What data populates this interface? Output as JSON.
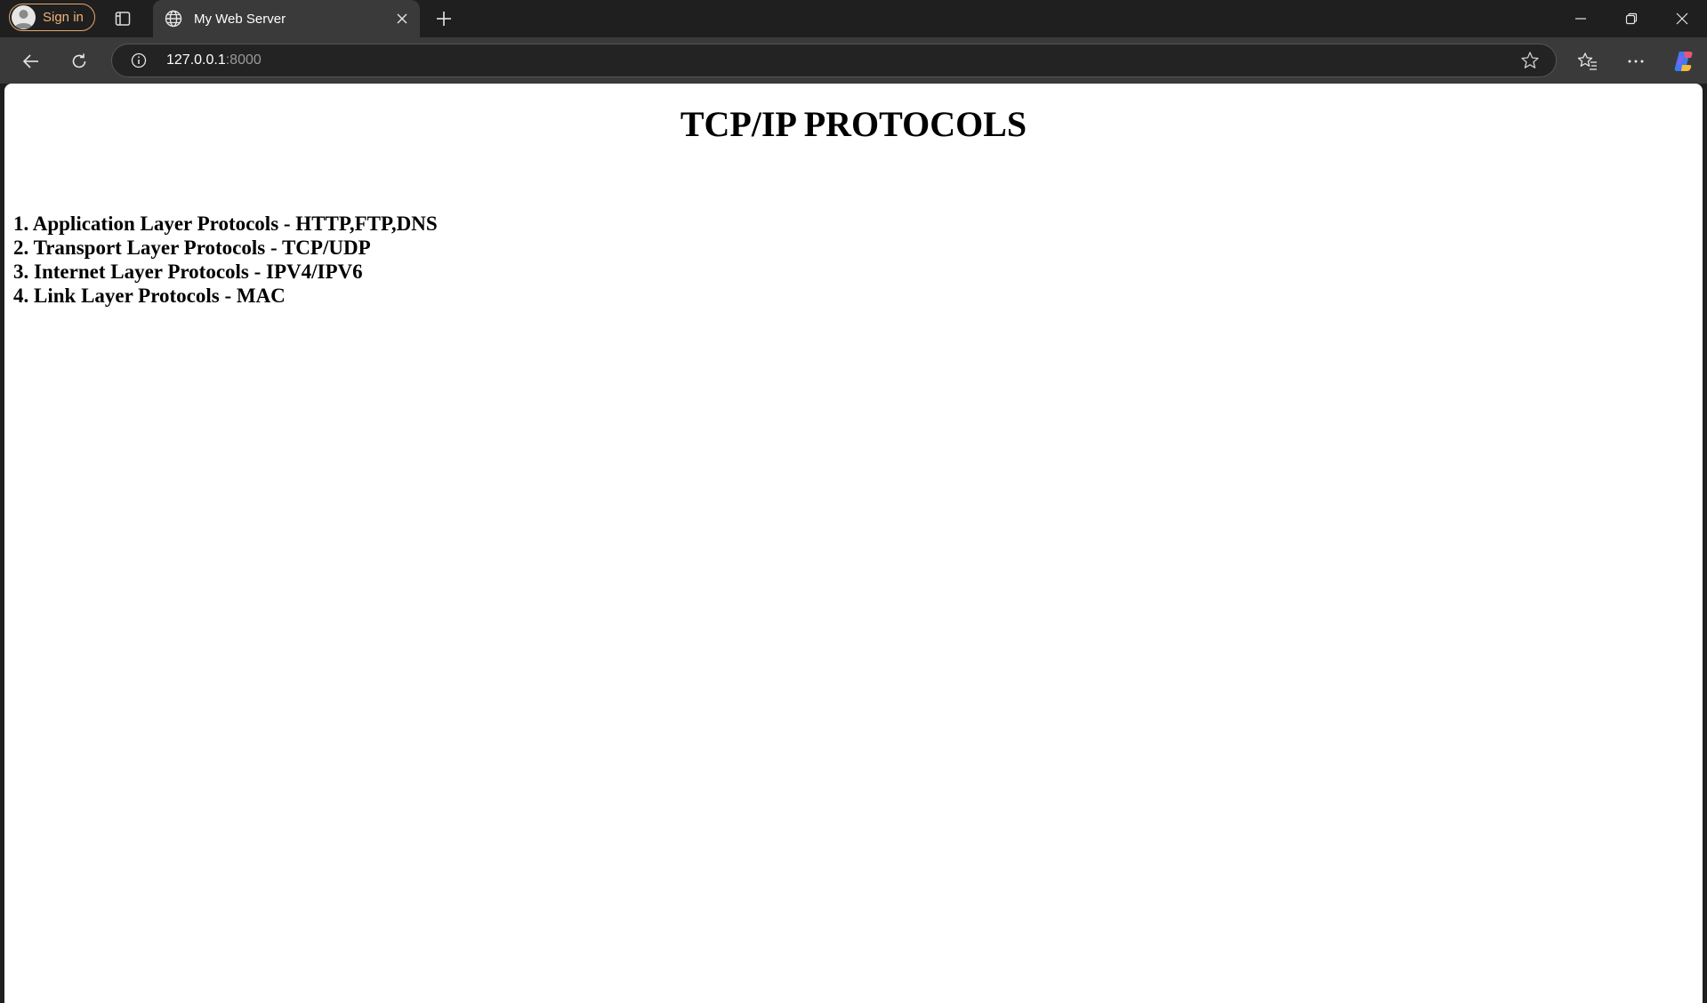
{
  "browser": {
    "signin_label": "Sign in",
    "tab": {
      "title": "My Web Server",
      "favicon": "globe-icon"
    },
    "address": {
      "host": "127.0.0.1",
      "port": ":8000"
    },
    "icons": {
      "tab_actions": "tab-actions-icon",
      "close_tab": "close-icon",
      "new_tab": "plus-icon",
      "back": "arrow-left-icon",
      "refresh": "refresh-icon",
      "site_info": "info-icon",
      "favorite": "star-icon",
      "favorites": "favorites-icon",
      "more": "ellipsis-icon",
      "copilot": "copilot-icon",
      "minimize": "minimize-icon",
      "restore": "restore-icon",
      "close_window": "close-icon"
    },
    "colors": {
      "titlebar": "#1f1f1f",
      "toolbar": "#3a3a3a",
      "signin_accent": "#e8a96a"
    }
  },
  "page": {
    "title": "TCP/IP PROTOCOLS",
    "items": [
      "1. Application Layer Protocols - HTTP,FTP,DNS",
      "2. Transport Layer Protocols - TCP/UDP",
      "3. Internet Layer Protocols - IPV4/IPV6",
      "4. Link Layer Protocols - MAC"
    ]
  }
}
